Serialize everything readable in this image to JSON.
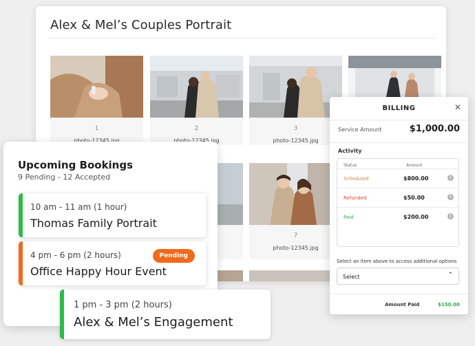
{
  "gallery": {
    "title": "Alex & Mel’s Couples Portrait",
    "photos": [
      {
        "number": "1",
        "filename": "photo-12345.jpg"
      },
      {
        "number": "2",
        "filename": "photo-12345.jpg"
      },
      {
        "number": "3",
        "filename": "photo-12345.jpg"
      },
      {
        "number": "",
        "filename": ""
      },
      {
        "number": "",
        "filename": ""
      },
      {
        "number": "",
        "filename": ""
      },
      {
        "number": "7",
        "filename": "photo-12345.jpg"
      }
    ]
  },
  "billing": {
    "title": "BILLING",
    "close_icon": "close-icon",
    "service_amount_label": "Service Amount",
    "service_amount_value": "$1,000.00",
    "activity_label": "Activity",
    "columns": {
      "status": "Status",
      "amount": "Amount"
    },
    "rows": [
      {
        "status": "Scheduled",
        "amount": "$800.00",
        "color": "#d18a3d"
      },
      {
        "status": "Refunded",
        "amount": "$50.00",
        "color": "#d9452e"
      },
      {
        "status": "Paid",
        "amount": "$200.00",
        "color": "#2fa84f"
      }
    ],
    "hint": "Select an item above to access additional options",
    "select_value": "Select",
    "amount_paid_label": "Amount Paid",
    "amount_paid_value": "$150.00"
  },
  "bookings": {
    "title": "Upcoming Bookings",
    "summary": "9 Pending - 12 Accepted",
    "events": [
      {
        "time": "10 am - 11 am (1 hour)",
        "name": "Thomas Family Portrait",
        "accent": "#2dbb45"
      },
      {
        "time": "4 pm - 6 pm (2 hours)",
        "name": "Office Happy Hour Event",
        "accent": "#f06a1d",
        "badge": "Pending"
      },
      {
        "time": "1 pm - 3 pm (2 hours)",
        "name": "Alex & Mel’s Engagement",
        "accent": "#2dbb45"
      }
    ]
  }
}
